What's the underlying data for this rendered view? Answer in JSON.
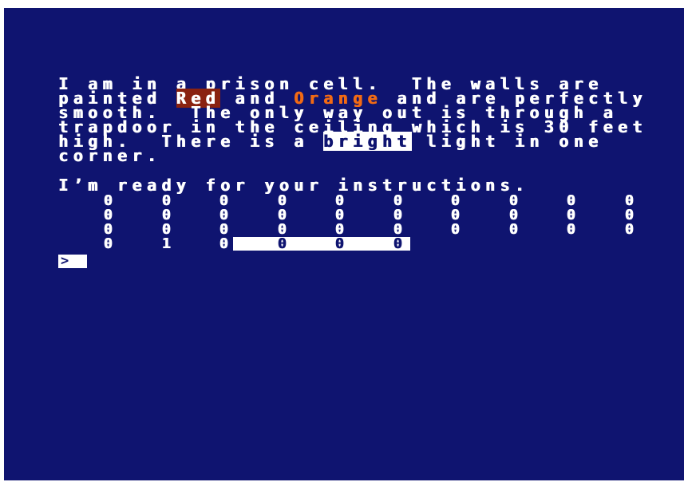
{
  "screen": {
    "background": "#0f1470",
    "text_color": "#ffffff",
    "red_highlight": "#8a2210",
    "orange_text": "#f26a14"
  },
  "description": {
    "line1": "I am in a prison cell.  The walls are",
    "line2_before": "painted ",
    "line2_red": "Red",
    "line2_mid": " and ",
    "line2_orange": "Orange",
    "line2_after": " and are perfectly",
    "line3": "smooth.  The only way out is through a",
    "line4": "trapdoor in the ceiling which is 30 feet",
    "line5_before": "high.  There is a ",
    "line5_inverse": "bright",
    "line5_after": " light in one",
    "line6": "corner."
  },
  "status": {
    "ready_message": "I’m ready for your instructions."
  },
  "grid": {
    "rows": [
      [
        "0",
        "0",
        "0",
        "0",
        "0",
        "0",
        "0",
        "0",
        "0",
        "0"
      ],
      [
        "0",
        "0",
        "0",
        "0",
        "0",
        "0",
        "0",
        "0",
        "0",
        "0"
      ],
      [
        "0",
        "0",
        "0",
        "0",
        "0",
        "0",
        "0",
        "0",
        "0",
        "0"
      ],
      [
        "0",
        "1",
        "0",
        "0",
        "0",
        "0"
      ]
    ]
  },
  "input": {
    "prompt_symbol": ">"
  }
}
